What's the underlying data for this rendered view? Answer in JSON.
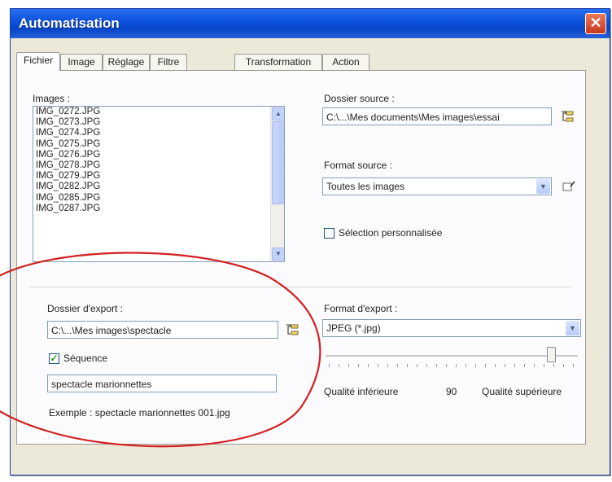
{
  "window": {
    "title": "Automatisation",
    "close_glyph": "✕"
  },
  "tabs": [
    {
      "label": "Fichier"
    },
    {
      "label": "Image"
    },
    {
      "label": "Réglage"
    },
    {
      "label": "Filtre"
    },
    {
      "label": "Transformation"
    },
    {
      "label": "Action"
    }
  ],
  "images": {
    "label": "Images :",
    "items": [
      "IMG_0272.JPG",
      "IMG_0273.JPG",
      "IMG_0274.JPG",
      "IMG_0275.JPG",
      "IMG_0276.JPG",
      "IMG_0278.JPG",
      "IMG_0279.JPG",
      "IMG_0282.JPG",
      "IMG_0285.JPG",
      "IMG_0287.JPG"
    ]
  },
  "source": {
    "folder_label": "Dossier source :",
    "folder_value": "C:\\...\\Mes documents\\Mes images\\essai",
    "format_label": "Format source :",
    "format_value": "Toutes les images",
    "custom_selection_label": "Sélection personnalisée",
    "custom_selection_checked": false
  },
  "export": {
    "folder_label": "Dossier d'export :",
    "folder_value": "C:\\...\\Mes images\\spectacle",
    "sequence_label": "Séquence",
    "sequence_checked": true,
    "sequence_value": "spectacle marionnettes",
    "example_text": "Exemple : spectacle marionnettes 001.jpg",
    "format_label": "Format d'export :",
    "format_value": "JPEG (*.jpg)",
    "quality_low_label": "Qualité inférieure",
    "quality_value": "90",
    "quality_high_label": "Qualité supérieure"
  },
  "icons": {
    "folder_browse": "folder-tree-icon",
    "format_edit": "format-edit-icon",
    "dropdown": "chevron-down-icon"
  },
  "colors": {
    "title_bar": "#0a4fd8",
    "annotation": "#d42020",
    "checkmark": "#21a121"
  }
}
